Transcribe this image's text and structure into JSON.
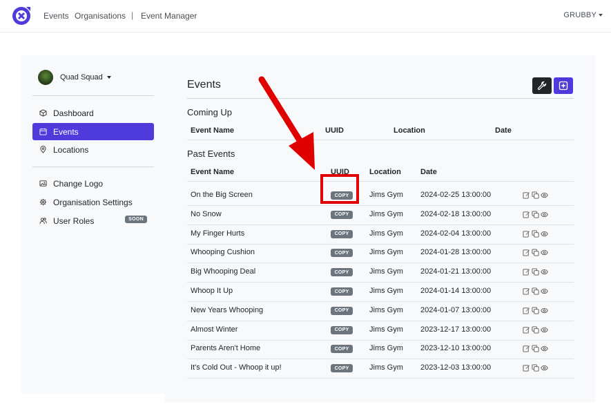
{
  "nav": {
    "links": [
      "Events",
      "Organisations"
    ],
    "separator": "|",
    "section": "Event Manager",
    "user": "GRUBBY"
  },
  "sidebar": {
    "org_name": "Quad Squad",
    "items": [
      {
        "label": "Dashboard",
        "icon": "cube-icon"
      },
      {
        "label": "Events",
        "icon": "calendar-icon",
        "active": true
      },
      {
        "label": "Locations",
        "icon": "location-pin-icon"
      }
    ],
    "settings_items": [
      {
        "label": "Change Logo",
        "icon": "image-icon"
      },
      {
        "label": "Organisation Settings",
        "icon": "gear-icon"
      },
      {
        "label": "User Roles",
        "icon": "users-icon",
        "badge": "SOON"
      }
    ]
  },
  "main": {
    "title": "Events",
    "coming_up": {
      "title": "Coming Up",
      "headers": [
        "Event Name",
        "UUID",
        "Location",
        "Date"
      ]
    },
    "past": {
      "title": "Past Events",
      "headers": [
        "Event Name",
        "UUID",
        "Location",
        "Date"
      ],
      "copy_label": "COPY",
      "rows": [
        {
          "name": "On the Big Screen",
          "location": "Jims Gym",
          "date": "2024-02-25 13:00:00"
        },
        {
          "name": "No Snow",
          "location": "Jims Gym",
          "date": "2024-02-18 13:00:00"
        },
        {
          "name": "My Finger Hurts",
          "location": "Jims Gym",
          "date": "2024-02-04 13:00:00"
        },
        {
          "name": "Whooping Cushion",
          "location": "Jims Gym",
          "date": "2024-01-28 13:00:00"
        },
        {
          "name": "Big Whooping Deal",
          "location": "Jims Gym",
          "date": "2024-01-21 13:00:00"
        },
        {
          "name": "Whoop It Up",
          "location": "Jims Gym",
          "date": "2024-01-14 13:00:00"
        },
        {
          "name": "New Years Whooping",
          "location": "Jims Gym",
          "date": "2024-01-07 13:00:00"
        },
        {
          "name": "Almost Winter",
          "location": "Jims Gym",
          "date": "2023-12-17 13:00:00"
        },
        {
          "name": "Parents Aren't Home",
          "location": "Jims Gym",
          "date": "2023-12-10 13:00:00"
        },
        {
          "name": "It's Cold Out - Whoop it up!",
          "location": "Jims Gym",
          "date": "2023-12-03 13:00:00"
        }
      ]
    }
  },
  "colors": {
    "accent": "#4f3bdc",
    "annotation": "#e00000",
    "badge": "#6c757d"
  }
}
